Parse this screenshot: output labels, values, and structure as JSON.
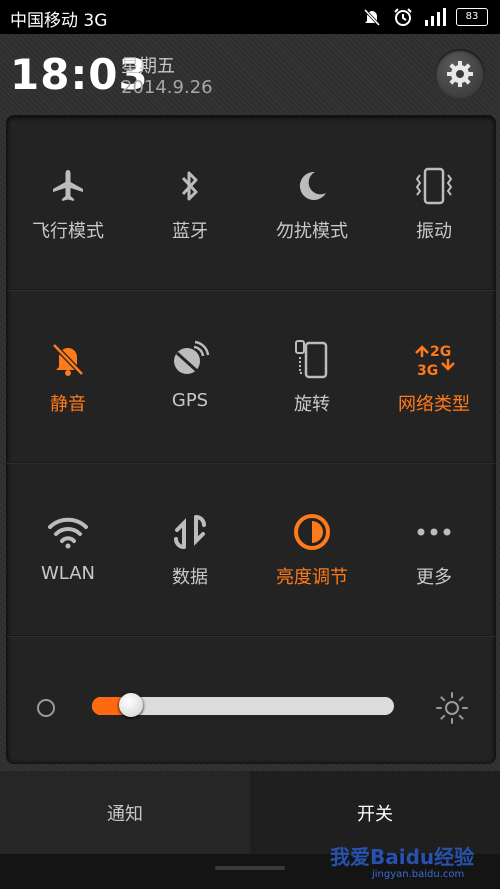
{
  "status_bar": {
    "carrier": "中国移动 3G",
    "icons": [
      "mute-icon",
      "alarm-icon",
      "signal-icon"
    ],
    "battery": "83"
  },
  "header": {
    "time": "18:03",
    "weekday": "星期五",
    "date": "2014.9.26"
  },
  "toggles": [
    {
      "label": "飞行模式",
      "icon": "airplane-icon",
      "active": false
    },
    {
      "label": "蓝牙",
      "icon": "bluetooth-icon",
      "active": false
    },
    {
      "label": "勿扰模式",
      "icon": "moon-icon",
      "active": false
    },
    {
      "label": "振动",
      "icon": "vibrate-icon",
      "active": false
    },
    {
      "label": "静音",
      "icon": "mute-bell-icon",
      "active": true
    },
    {
      "label": "GPS",
      "icon": "gps-icon",
      "active": false
    },
    {
      "label": "旋转",
      "icon": "rotate-icon",
      "active": false
    },
    {
      "label": "网络类型",
      "icon": "network-type-icon",
      "active": true,
      "badge_top": "2G",
      "badge_bottom": "3G"
    },
    {
      "label": "WLAN",
      "icon": "wifi-icon",
      "active": false
    },
    {
      "label": "数据",
      "icon": "data-arrows-icon",
      "active": false
    },
    {
      "label": "亮度调节",
      "icon": "brightness-auto-icon",
      "active": true
    },
    {
      "label": "更多",
      "icon": "more-icon",
      "active": false
    }
  ],
  "brightness": {
    "level": 0.09
  },
  "tabs": {
    "notifications": "通知",
    "toggles": "开关"
  },
  "watermark": {
    "text": "我爱Baidu经验",
    "sub": "jingyan.baidu.com"
  },
  "colors": {
    "accent": "#ff7a1a",
    "inactive_icon": "#bcbcbc",
    "background": "#1a1a1a"
  }
}
